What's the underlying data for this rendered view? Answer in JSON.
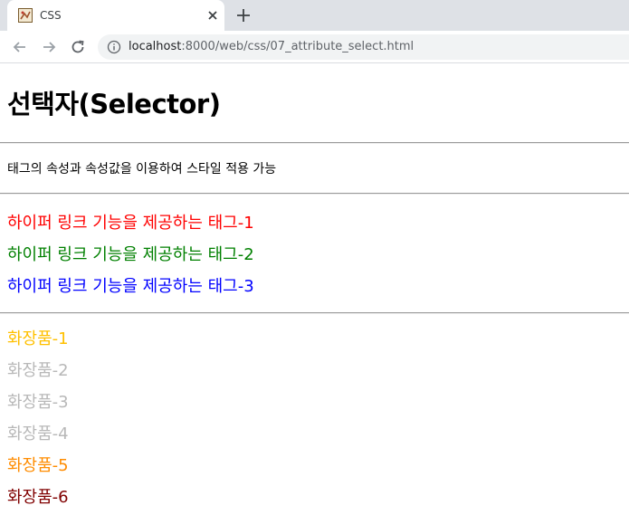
{
  "browser": {
    "tab_title": "CSS",
    "url_host": "localhost",
    "url_path": ":8000/web/css/07_attribute_select.html"
  },
  "page": {
    "heading": "선택자(Selector)",
    "description": "태그의 속성과 속성값을 이용하여 스타일 적용 가능",
    "links": [
      {
        "label": "하이퍼 링크 기능을 제공하는 태그-1",
        "color": "#ff0000"
      },
      {
        "label": "하이퍼 링크 기능을 제공하는 태그-2",
        "color": "#008000"
      },
      {
        "label": "하이퍼 링크 기능을 제공하는 태그-3",
        "color": "#0000ff"
      }
    ],
    "products": [
      {
        "label": "화장품-1",
        "color": "#ffc000"
      },
      {
        "label": "화장품-2",
        "color": "#b8b8b8"
      },
      {
        "label": "화장품-3",
        "color": "#b8b8b8"
      },
      {
        "label": "화장품-4",
        "color": "#b8b8b8"
      },
      {
        "label": "화장품-5",
        "color": "#ff8c00"
      },
      {
        "label": "화장품-6",
        "color": "#800000"
      }
    ]
  }
}
